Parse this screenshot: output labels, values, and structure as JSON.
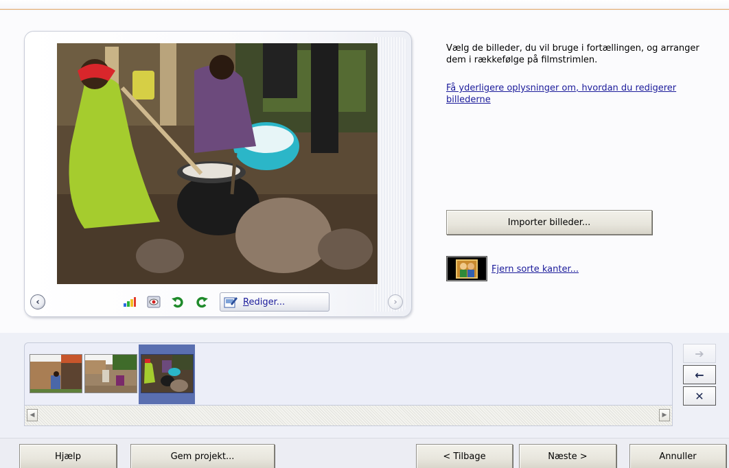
{
  "instructions": "Vælg de billeder, du vil bruge i fortællingen, og arranger dem i rækkefølge på filmstrimlen.",
  "info_link": "Få yderligere oplysninger om, hvordan du redigerer billederne",
  "import_button": "Importer billeder...",
  "remove_borders_link": "Fjern sorte kanter...",
  "preview": {
    "edit_button": "Rediger..."
  },
  "footer": {
    "help": "Hjælp",
    "save_project": "Gem projekt...",
    "back": "< Tilbage",
    "next": "Næste >",
    "cancel": "Annuller"
  },
  "colors": {
    "link": "#1a1a9a",
    "selection": "#5a6fb0",
    "accent_line": "#e6a861"
  },
  "icons": {
    "prev": "chevron-left-icon",
    "next": "chevron-right-icon",
    "color_correct": "color-bars-icon",
    "red_eye": "red-eye-icon",
    "rotate_left": "rotate-left-icon",
    "rotate_right": "rotate-right-icon",
    "edit": "edit-picture-icon",
    "move_right": "arrow-right-icon",
    "move_left": "arrow-left-icon",
    "delete": "delete-x-icon"
  }
}
